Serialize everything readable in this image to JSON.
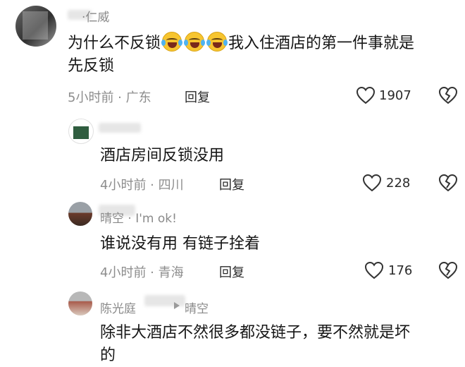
{
  "comments": [
    {
      "username": "·仁威",
      "text_line1": "为什么不反锁",
      "text_line1b": "我入住酒店的第一件事就是",
      "text_line2": "先反锁",
      "meta": "5小时前 · 广东",
      "reply_label": "回复",
      "likes": "1907"
    },
    {
      "username": "",
      "text": "酒店房间反锁没用",
      "meta": "4小时前 · 四川",
      "reply_label": "回复",
      "likes": "228"
    },
    {
      "username": "晴空 · I'm ok!",
      "text": "谁说没有用 有链子拴着",
      "meta": "4小时前 · 青海",
      "reply_label": "回复",
      "likes": "176"
    },
    {
      "username": "陈光庭",
      "reply_to": "晴空",
      "text_line1": "除非大酒店不然很多都没链子，要不然就是坏",
      "text_line2": "的"
    }
  ],
  "icons": {
    "like": "heart-outline-icon",
    "dislike": "broken-heart-icon",
    "emoji": "rolling-laughing-emoji-icon",
    "reply_arrow": "triangle-right-icon"
  }
}
